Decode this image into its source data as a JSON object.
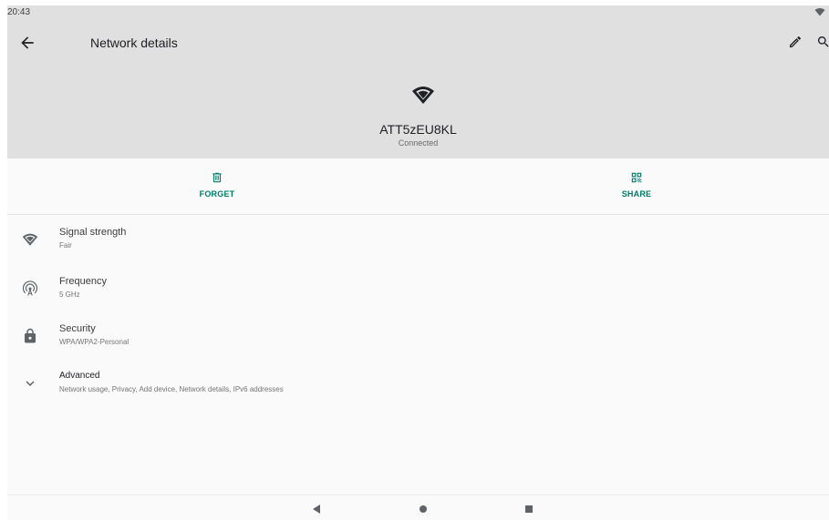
{
  "status_bar": {
    "time": "20:43",
    "wifi_icon": "wifi-icon"
  },
  "app_bar": {
    "title": "Network details",
    "back_icon": "arrow-back-icon",
    "edit_icon": "pencil-icon",
    "search_icon": "search-icon"
  },
  "network": {
    "name": "ATT5zEU8KL",
    "status": "Connected"
  },
  "actions": [
    {
      "label": "FORGET",
      "icon": "trash-icon"
    },
    {
      "label": "SHARE",
      "icon": "qr-code-icon"
    }
  ],
  "details": [
    {
      "title": "Signal strength",
      "value": "Fair",
      "icon": "wifi-icon"
    },
    {
      "title": "Frequency",
      "value": "5 GHz",
      "icon": "antenna-icon"
    },
    {
      "title": "Security",
      "value": "WPA/WPA2-Personal",
      "icon": "lock-icon"
    },
    {
      "title": "Advanced",
      "value": "Network usage, Privacy, Add device, Network details, IPv6 addresses",
      "icon": "chevron-down-icon"
    }
  ],
  "nav_bar": {
    "back_icon": "triangle-back-icon",
    "home_icon": "circle-home-icon",
    "recents_icon": "square-recents-icon"
  },
  "colors": {
    "header_bg": "#e0e0e0",
    "accent": "#00796b",
    "page_bg": "#fafafa"
  }
}
